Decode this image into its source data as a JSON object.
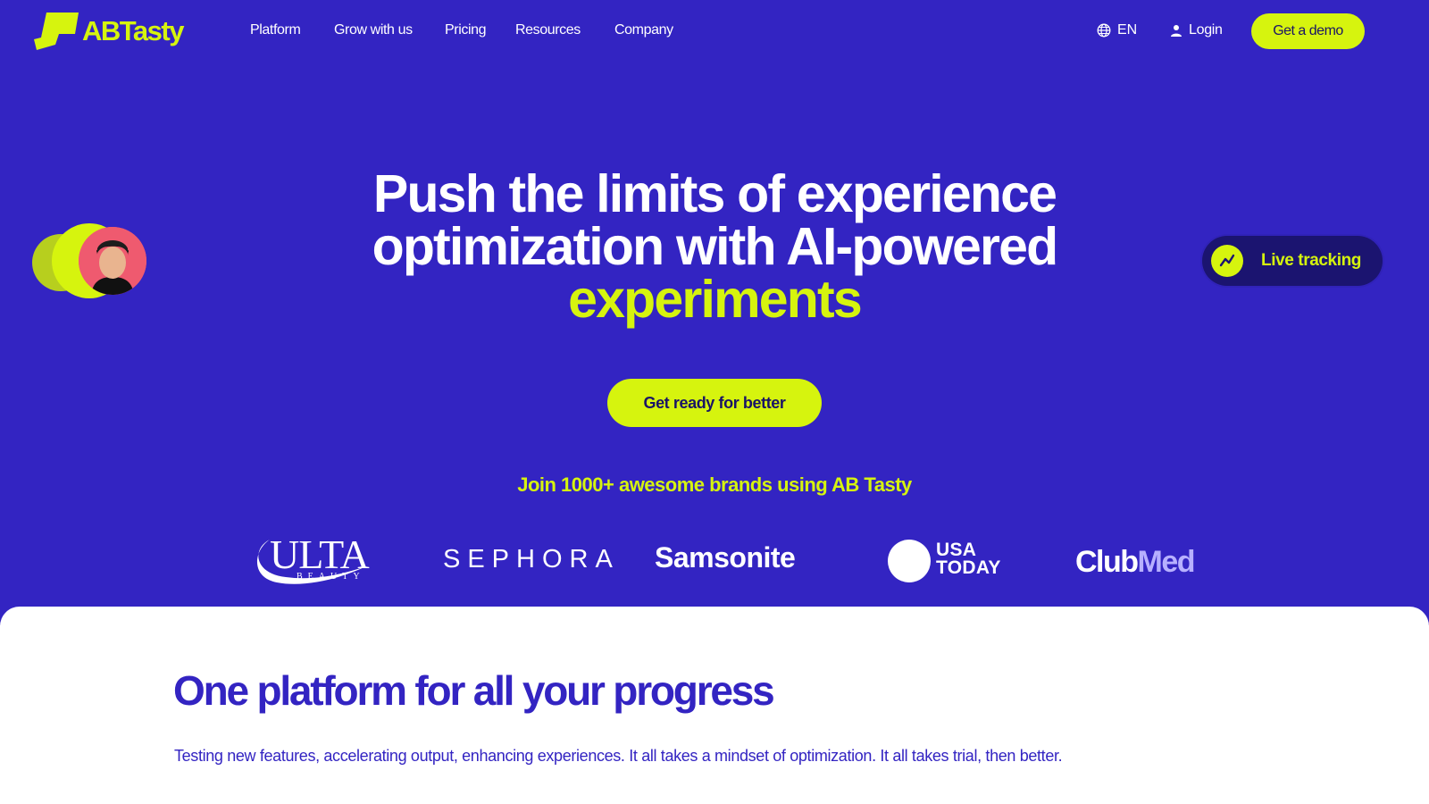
{
  "brand": {
    "name": "ABTasty",
    "accent": "#d6f40e",
    "primary": "#3324c2"
  },
  "nav": {
    "links": [
      "Platform",
      "Grow with us",
      "Pricing",
      "Resources",
      "Company"
    ],
    "language": "EN",
    "login": "Login",
    "demo": "Get a demo"
  },
  "hero": {
    "headline_line1": "Push the limits of experience",
    "headline_line2": "optimization with AI-powered",
    "headline_accent": "experiments",
    "cta": "Get ready for better",
    "brands_caption": "Join 1000+ awesome brands using AB Tasty",
    "live_tracking": "Live tracking"
  },
  "logos": {
    "ulta": "ULTA",
    "ulta_sub": "BEAUTY",
    "sephora": "SEPHORA",
    "samsonite": "Samsonite",
    "usatoday_1": "USA",
    "usatoday_2": "TODAY",
    "clubmed_1": "Club",
    "clubmed_2": "Med"
  },
  "section": {
    "title": "One platform for all your progress",
    "description": "Testing new features, accelerating output, enhancing experiences. It all takes a mindset of optimization. It all takes trial, then better."
  }
}
